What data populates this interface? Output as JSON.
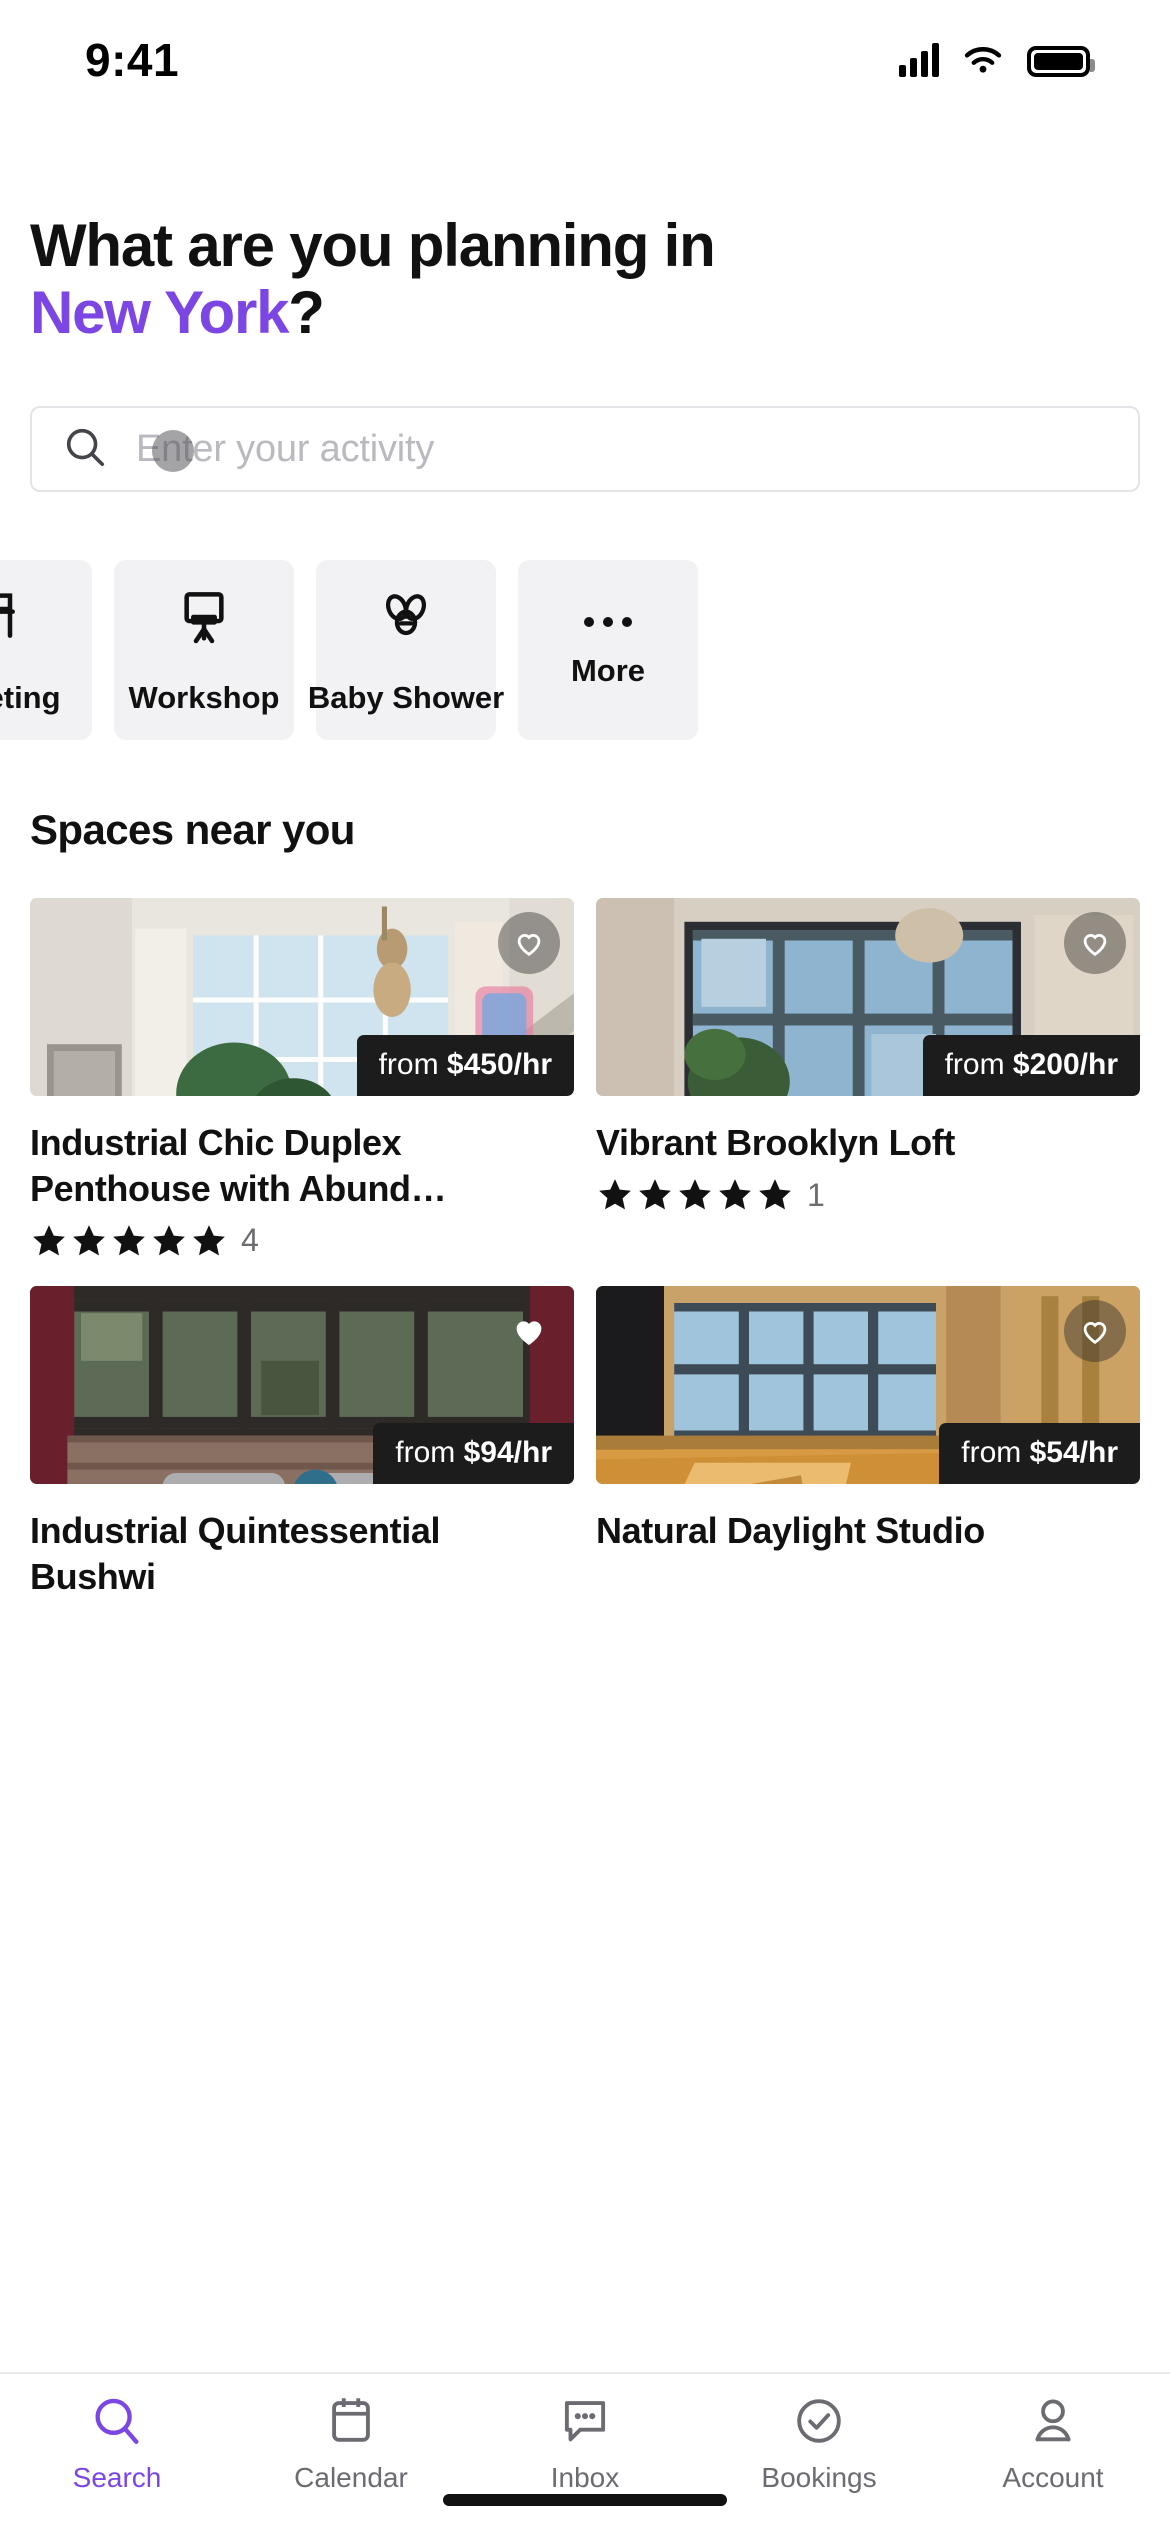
{
  "statusbar": {
    "time": "9:41",
    "signal_icon": "cellular-signal-icon",
    "wifi_icon": "wifi-icon",
    "battery_icon": "battery-full-icon"
  },
  "header": {
    "line1": "What are you planning in",
    "city": "New York",
    "suffix": "?",
    "city_color": "#7B46E3"
  },
  "search": {
    "placeholder": "Enter your activity",
    "value": "",
    "icon": "search-icon"
  },
  "categories": [
    {
      "label": "Meeting",
      "icon": "meeting-chair-icon"
    },
    {
      "label": "Workshop",
      "icon": "easel-flipchart-icon"
    },
    {
      "label": "Baby Shower",
      "icon": "pacifier-icon"
    },
    {
      "label": "More",
      "icon": "ellipsis-icon"
    }
  ],
  "spaces_section": {
    "title": "Spaces near you"
  },
  "listings": [
    {
      "title": "Industrial Chic Duplex Penthouse with Abund…",
      "price": "from $450/hr",
      "price_prefix": "from ",
      "price_value": "$450/hr",
      "rating": 5,
      "review_count": "4",
      "favorited": false,
      "heart_icon": "heart-outline-icon"
    },
    {
      "title": "Vibrant Brooklyn Loft",
      "price": "from $200/hr",
      "price_prefix": "from ",
      "price_value": "$200/hr",
      "rating": 5,
      "review_count": "1",
      "favorited": false,
      "heart_icon": "heart-outline-icon"
    },
    {
      "title": "Industrial Quintessential Bushwi",
      "price": "from $94/hr",
      "price_prefix": "from ",
      "price_value": "$94/hr",
      "rating": 0,
      "review_count": "",
      "favorited": true,
      "heart_icon": "heart-filled-icon"
    },
    {
      "title": "Natural Daylight Studio",
      "price": "from $54/hr",
      "price_prefix": "from ",
      "price_value": "$54/hr",
      "rating": 0,
      "review_count": "",
      "favorited": false,
      "heart_icon": "heart-outline-icon"
    }
  ],
  "tabbar": {
    "active_color": "#7B46E3",
    "inactive_color": "#6B6B72",
    "items": [
      {
        "label": "Search",
        "icon": "search-icon",
        "active": true
      },
      {
        "label": "Calendar",
        "icon": "calendar-icon",
        "active": false
      },
      {
        "label": "Inbox",
        "icon": "chat-bubble-icon",
        "active": false
      },
      {
        "label": "Bookings",
        "icon": "check-circle-icon",
        "active": false
      },
      {
        "label": "Account",
        "icon": "user-icon",
        "active": false
      }
    ]
  }
}
